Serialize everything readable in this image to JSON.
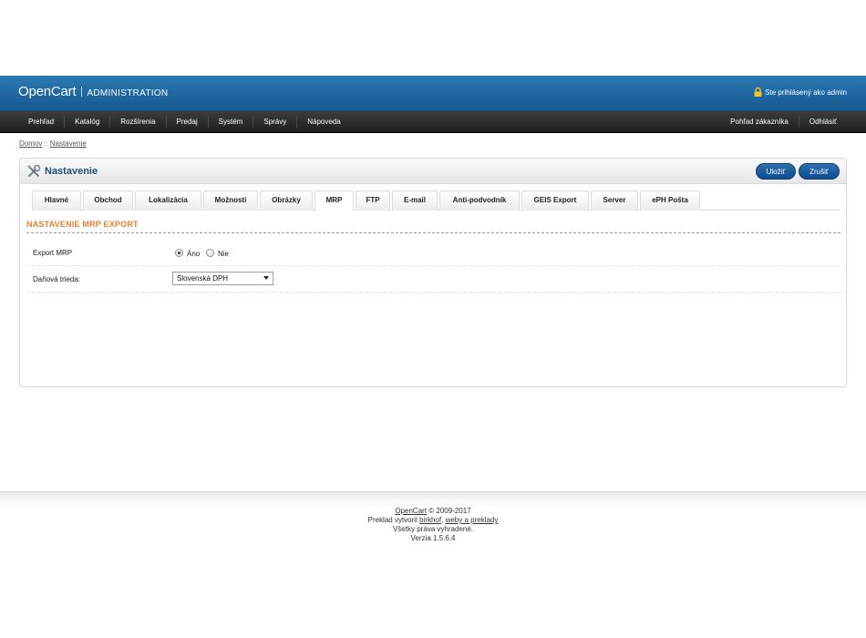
{
  "header": {
    "brand": "OpenCart",
    "subtitle": "ADMINISTRATION",
    "login_text": "Ste prihlásený ako admin"
  },
  "menu": {
    "left": [
      "Prehľad",
      "Katalóg",
      "Rozšírenia",
      "Predaj",
      "Systém",
      "Správy",
      "Nápoveda"
    ],
    "right": [
      "Pohľad zákazníka",
      "Odhlásiť"
    ]
  },
  "breadcrumb": {
    "home": "Domov",
    "separator": "::",
    "current": "Nastavenie"
  },
  "box": {
    "title": "Nastavenie",
    "save_label": "Uložiť",
    "cancel_label": "Zrušiť"
  },
  "tabs": [
    "Hlavné",
    "Obchod",
    "Lokalizácia",
    "Možnosti",
    "Obrázky",
    "MRP",
    "FTP",
    "E-mail",
    "Anti-podvodník",
    "GEIS Export",
    "Server",
    "ePH Pošta"
  ],
  "active_tab": "MRP",
  "section": {
    "title": "NASTAVENIE MRP EXPORT",
    "export_label": "Export MRP",
    "export_options": {
      "yes": "Áno",
      "no": "Nie"
    },
    "export_value": "Áno",
    "tax_label": "Daňová trieda:",
    "tax_value": "Slovenská DPH"
  },
  "footer": {
    "opencart_link": "OpenCart",
    "copyright": "© 2009-2017",
    "translation_prefix": "Preklad vytvoril",
    "translator_link": "birkhof",
    "translation_link2": "weby a preklady",
    "rights": "Všetky práva vyhradené.",
    "version": "Verzia 1.5.6.4"
  },
  "colors": {
    "header_blue": "#1f66a0",
    "menu_dark": "#2a2a2a",
    "section_orange": "#e4832c",
    "title_blue": "#1c4f79",
    "button_blue": "#0d4a8f"
  }
}
